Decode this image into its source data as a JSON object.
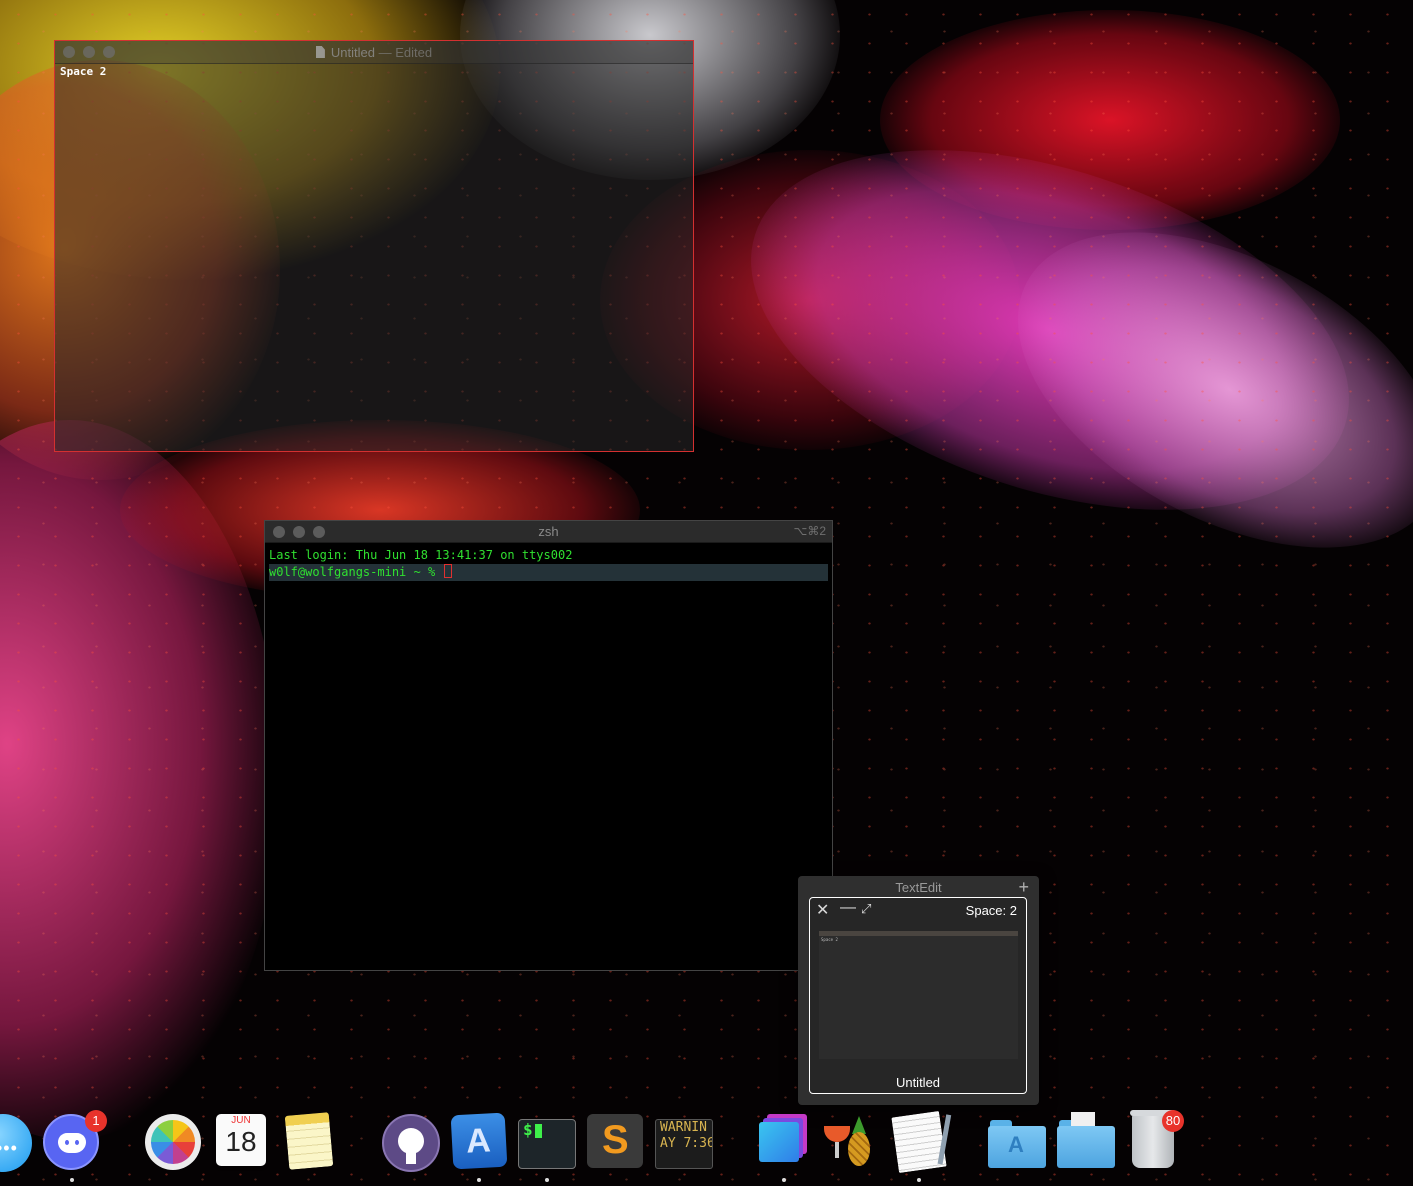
{
  "textedit_window": {
    "title": "Untitled",
    "edited_suffix": "— Edited",
    "content": "Space 2"
  },
  "terminal_window": {
    "title": "zsh",
    "shortcut": "⌥⌘2",
    "last_login": "Last login: Thu Jun 18 13:41:37 on ttys002",
    "prompt": "w0lf@wolfgangs-mini ~ % "
  },
  "switcher": {
    "app_name": "TextEdit",
    "space_label": "Space: 2",
    "window_title": "Untitled",
    "thumbnail_text": "Space 2"
  },
  "dock": {
    "discord_badge": "1",
    "calendar_month": "JUN",
    "calendar_day": "18",
    "console_line1": "WARNIN",
    "console_line2": "AY 7:36",
    "trash_badge": "80"
  },
  "colors": {
    "terminal_text": "#30e030",
    "highlight_border": "#d43030",
    "badge": "#e8332b"
  },
  "icons": [
    "messages-icon",
    "discord-icon",
    "photos-icon",
    "calendar-icon",
    "notes-icon",
    "github-desktop-icon",
    "xcode-icon",
    "terminal-icon",
    "sublime-text-icon",
    "console-icon",
    "layers-icon",
    "homebrew-icon",
    "textedit-icon",
    "applications-folder-icon",
    "documents-folder-icon",
    "trash-icon"
  ]
}
